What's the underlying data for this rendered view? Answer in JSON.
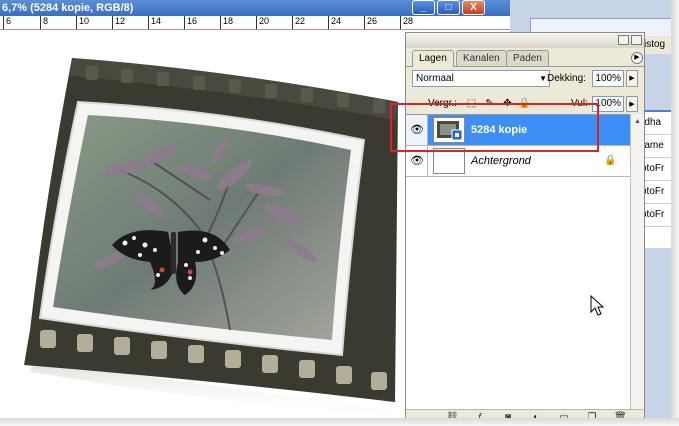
{
  "document": {
    "title": "6,7% (5284 kopie, RGB/8)",
    "window_buttons": [
      "_",
      "□",
      "X"
    ],
    "ruler_ticks": [
      "6",
      "8",
      "10",
      "12",
      "14",
      "16",
      "18",
      "20",
      "22",
      "24",
      "26",
      "28"
    ]
  },
  "background_window": {
    "title_fragment": "istog",
    "list_items": [
      "rdha",
      "rame",
      "otoFr",
      "otoFr",
      "otoFr"
    ]
  },
  "layers_panel": {
    "tabs": [
      {
        "label": "Lagen",
        "active": true
      },
      {
        "label": "Kanalen",
        "active": false
      },
      {
        "label": "Paden",
        "active": false
      }
    ],
    "blend_mode": "Normaal",
    "opacity_label": "Dekking:",
    "opacity_value": "100%",
    "lock_label": "Vergr.:",
    "fill_label": "Vul:",
    "fill_value": "100%",
    "layers": [
      {
        "name": "5284 kopie",
        "visible": true,
        "selected": true,
        "italic": false,
        "locked": false
      },
      {
        "name": "Achtergrond",
        "visible": true,
        "selected": false,
        "italic": true,
        "locked": true
      }
    ]
  },
  "icons": {
    "eye": "eye-icon",
    "lock": "lock-icon",
    "panel_menu": "panel-menu-icon",
    "cursor": "mouse-pointer-icon"
  },
  "colors": {
    "selection": "#3d8ef6",
    "highlight_box": "#d9242a",
    "panel_bg": "#ece9d8",
    "titlebar": "#3a6cc0",
    "film_frame": "#3b3a30"
  }
}
